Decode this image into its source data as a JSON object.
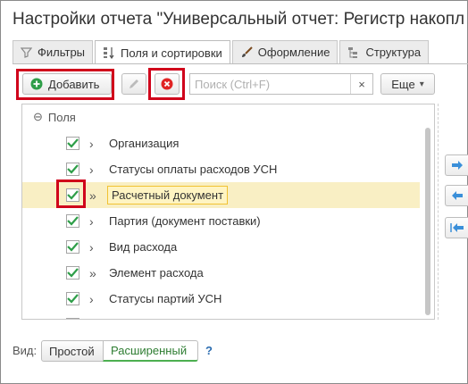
{
  "window": {
    "title": "Настройки отчета \"Универсальный отчет: Регистр накопле"
  },
  "tabs": [
    {
      "label": "Фильтры",
      "icon": "filter-icon"
    },
    {
      "label": "Поля и сортировки",
      "icon": "fields-list-icon"
    },
    {
      "label": "Оформление",
      "icon": "brush-icon"
    },
    {
      "label": "Структура",
      "icon": "structure-icon"
    }
  ],
  "toolbar": {
    "add_label": "Добавить",
    "search_placeholder": "Поиск (Ctrl+F)",
    "clear_symbol": "×",
    "more_label": "Еще",
    "more_arrow": "▾"
  },
  "tree": {
    "root_label": "Поля",
    "root_toggle": "⊖",
    "items": [
      {
        "label": "Организация",
        "checked": true,
        "arrow": "›"
      },
      {
        "label": "Статусы оплаты расходов УСН",
        "checked": true,
        "arrow": "›"
      },
      {
        "label": "Расчетный документ",
        "checked": true,
        "arrow": "»",
        "selected": true
      },
      {
        "label": "Партия (документ поставки)",
        "checked": true,
        "arrow": "›"
      },
      {
        "label": "Вид расхода",
        "checked": true,
        "arrow": "›"
      },
      {
        "label": "Элемент расхода",
        "checked": true,
        "arrow": "»"
      },
      {
        "label": "Статусы партий УСН",
        "checked": true,
        "arrow": "›"
      }
    ]
  },
  "footer": {
    "view_label": "Вид:",
    "mode_simple": "Простой",
    "mode_extended": "Расширенный",
    "help": "?"
  },
  "colors": {
    "highlight": "#d0021b",
    "selected_row": "#f9efc4",
    "check": "#2e9e48",
    "accent_blue": "#3a8fd9"
  }
}
